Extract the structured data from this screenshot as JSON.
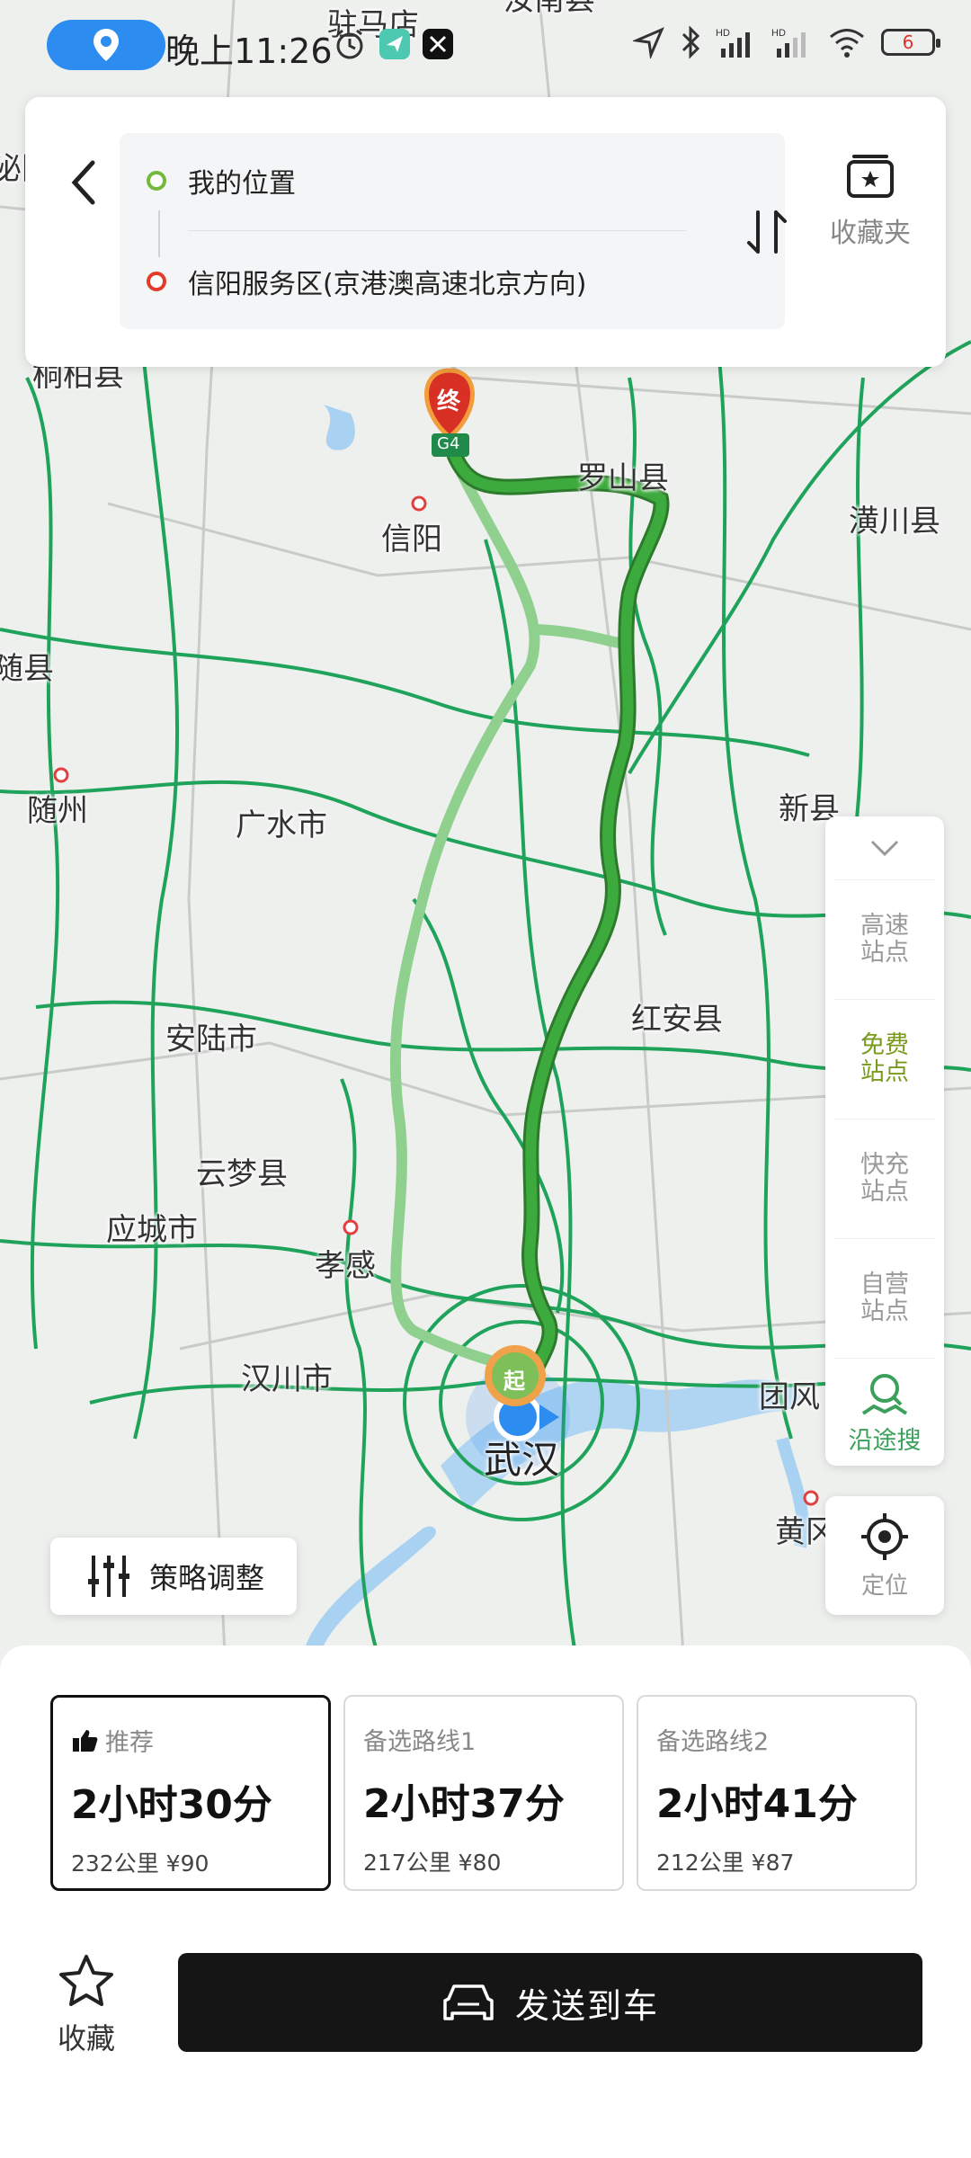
{
  "status_bar": {
    "time": "晚上11:26",
    "battery": "6",
    "network_badges": [
      "HD",
      "HD"
    ]
  },
  "route_header": {
    "origin": "我的位置",
    "destination": "信阳服务区(京港澳高速北京方向)",
    "favorites_folder_label": "收藏夹"
  },
  "map": {
    "labels": {
      "zhumadian": "驻马店",
      "runan": "汝南县",
      "tongbai": "桐柏县",
      "luoshan": "罗山县",
      "xinyang": "信阳",
      "huangchuan": "潢川县",
      "suixian": "随县",
      "suizhou": "随州",
      "guangshui": "广水市",
      "xinxian": "新县",
      "anlu": "安陆市",
      "hongan": "红安县",
      "yunmeng": "云梦县",
      "yingcheng": "应城市",
      "xiaogan": "孝感",
      "hanchuan": "汉川市",
      "tuanfeng": "团风",
      "wuhan": "武汉",
      "huanggang": "黄冈",
      "biyang": "泌阳"
    },
    "end_marker": "终",
    "start_marker": "起",
    "highway_shield": "G4",
    "colors": {
      "main_route": "#3daa3d",
      "alt_route": "#8fd08f",
      "road": "#1fa35a",
      "water": "#a9d2f2"
    }
  },
  "side_panel": {
    "items": [
      {
        "label": "高速\n站点",
        "line1": "高速",
        "line2": "站点",
        "active": false
      },
      {
        "label": "免费站点",
        "line1": "免费",
        "line2": "站点",
        "active": true
      },
      {
        "label": "快充站点",
        "line1": "快充",
        "line2": "站点",
        "active": false
      },
      {
        "label": "自营站点",
        "line1": "自营",
        "line2": "站点",
        "active": false
      }
    ],
    "search_along_label": "沿途搜",
    "locate_label": "定位"
  },
  "strategy_button": {
    "label": "策略调整"
  },
  "route_options": [
    {
      "tag": "推荐",
      "duration": "2小时30分",
      "meta": "232公里 ¥90",
      "selected": true
    },
    {
      "tag": "备选路线1",
      "duration": "2小时37分",
      "meta": "217公里 ¥80",
      "selected": false
    },
    {
      "tag": "备选路线2",
      "duration": "2小时41分",
      "meta": "212公里 ¥87",
      "selected": false
    }
  ],
  "actions": {
    "favorite_label": "收藏",
    "send_to_car_label": "发送到车"
  }
}
